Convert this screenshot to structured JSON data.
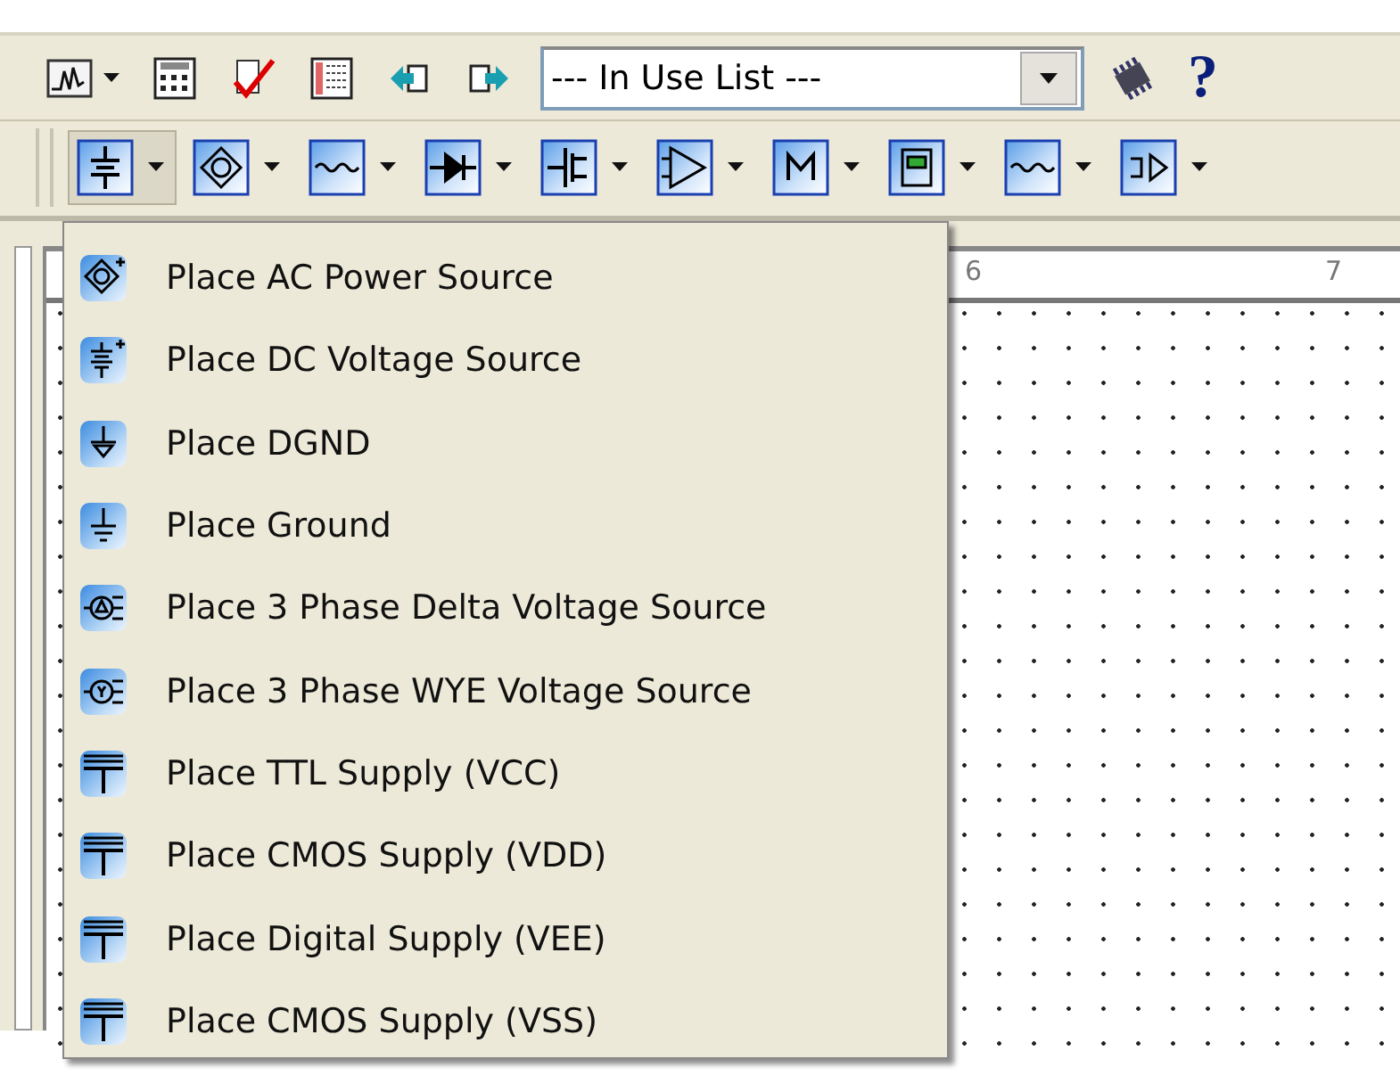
{
  "toolbar_top": {
    "buttons": [
      {
        "kind": "graph",
        "dropdown": true
      },
      {
        "kind": "grid",
        "dropdown": false
      },
      {
        "kind": "check",
        "dropdown": false
      },
      {
        "kind": "table",
        "dropdown": false
      },
      {
        "kind": "back",
        "dropdown": false
      },
      {
        "kind": "forward",
        "dropdown": false
      }
    ],
    "in_use_list": {
      "value": "--- In Use List ---"
    },
    "tool_buttons": [
      {
        "kind": "chip"
      }
    ],
    "help": "?"
  },
  "toolbar_components": [
    {
      "kind": "dc",
      "selected": true
    },
    {
      "kind": "ac",
      "selected": false
    },
    {
      "kind": "wave",
      "selected": false
    },
    {
      "kind": "diode",
      "selected": false
    },
    {
      "kind": "transistor",
      "selected": false
    },
    {
      "kind": "amp",
      "selected": false
    },
    {
      "kind": "misc",
      "selected": false
    },
    {
      "kind": "ic",
      "selected": false
    },
    {
      "kind": "wave2",
      "selected": false
    },
    {
      "kind": "play",
      "selected": false
    }
  ],
  "ruler": {
    "labels": [
      "6",
      "7"
    ]
  },
  "menu": [
    {
      "kind": "ac",
      "label": "Place AC Power Source"
    },
    {
      "kind": "dc",
      "label": "Place DC Voltage Source"
    },
    {
      "kind": "dgnd",
      "label": "Place DGND"
    },
    {
      "kind": "ground",
      "label": "Place Ground"
    },
    {
      "kind": "delta",
      "label": "Place 3 Phase Delta Voltage Source"
    },
    {
      "kind": "wye",
      "label": "Place 3 Phase WYE Voltage Source"
    },
    {
      "kind": "supply",
      "label": "Place TTL Supply (VCC)"
    },
    {
      "kind": "supply",
      "label": "Place CMOS Supply (VDD)"
    },
    {
      "kind": "supply",
      "label": "Place Digital Supply (VEE)"
    },
    {
      "kind": "supply",
      "label": "Place CMOS Supply (VSS)"
    }
  ]
}
